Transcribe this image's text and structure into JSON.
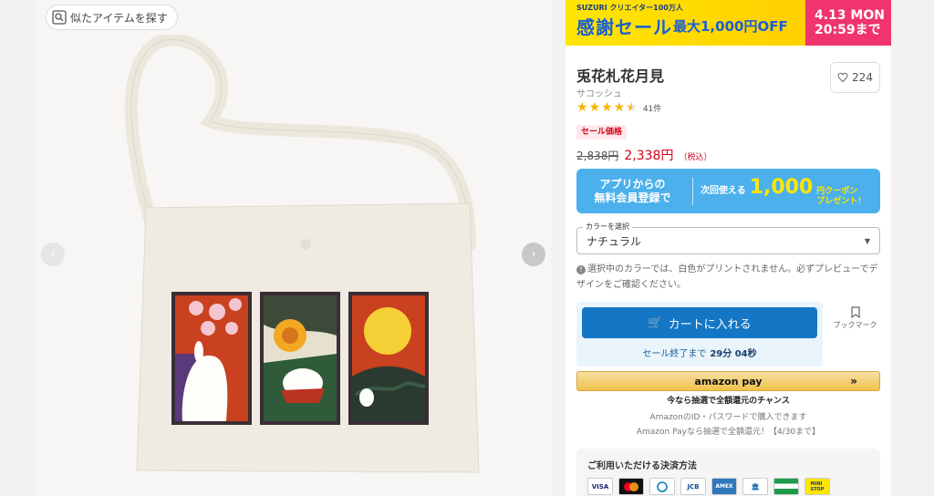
{
  "gallery": {
    "similar_label": "似たアイテムを探す",
    "prev_icon": "chevron-left-icon",
    "next_icon": "chevron-right-icon"
  },
  "banner": {
    "brand": "SUZURI クリエイター100万人",
    "headline": "感謝セール",
    "discount": "最大1,000円OFF",
    "date": "4.13 MON",
    "time": "20:59まで",
    "colors": {
      "left": "#ffd000",
      "right": "#f0346e",
      "text": "#1a5fd0"
    }
  },
  "product": {
    "title": "兎花札花月見",
    "type": "サコッシュ",
    "favorite_count": "224",
    "rating": 4.5,
    "review_count": "41件",
    "sale_badge": "セール価格",
    "old_price": "2,838円",
    "price": "2,338円",
    "tax_note": "（税込）"
  },
  "coupon": {
    "left_line1": "アプリからの",
    "left_line2": "無料会員登録で",
    "right_lead": "次回使える",
    "amount": "1,000",
    "unit": "円クーポン",
    "gift": "プレゼント！"
  },
  "color_select": {
    "label": "カラーを選択",
    "value": "ナチュラル"
  },
  "notice": "選択中のカラーでは、白色がプリントされません。必ずプレビューでデザインをご確認ください。",
  "cart": {
    "button_label": "カートに入れる",
    "timer_label": "セール終了まで",
    "timer_value": "29分 04秒"
  },
  "bookmark_label": "ブックマーク",
  "amazon": {
    "button_label": "amazon pay",
    "campaign": "今なら抽選で全額還元のチャンス",
    "note1": "AmazonのID・パスワードで購入できます",
    "note2": "Amazon Payなら抽選で全額還元！【4/30まで】"
  },
  "payment": {
    "title": "ご利用いただける決済方法",
    "methods": [
      "VISA",
      "Mastercard",
      "Diners",
      "JCB",
      "AMEX",
      "銀行振込",
      "ゆうちょ",
      "MINI STOP"
    ]
  }
}
